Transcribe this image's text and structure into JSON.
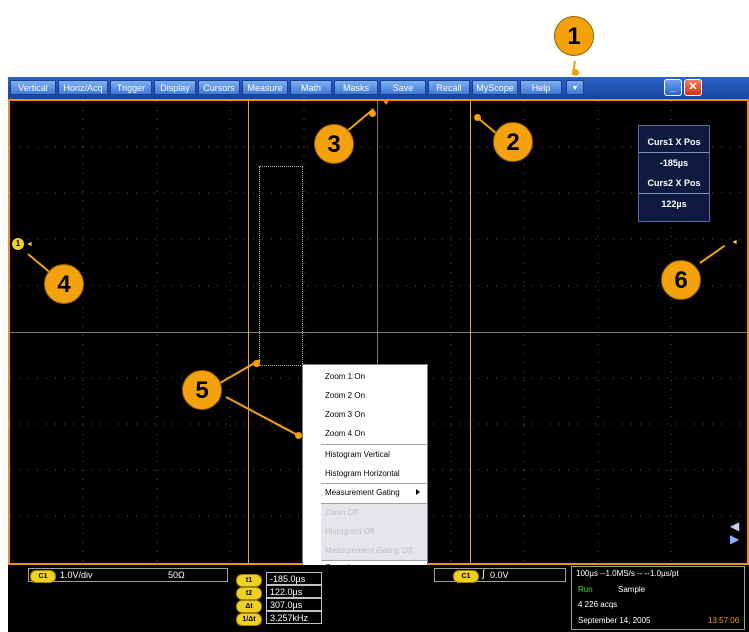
{
  "menubar": {
    "items": [
      "Vertical",
      "Horiz/Acq",
      "Trigger",
      "Display",
      "Cursors",
      "Measure",
      "Math",
      "Masks",
      "Save",
      "Recall",
      "MyScope",
      "Help"
    ],
    "dropdown_icon": "triangle-down-icon",
    "minimize_icon": "minimize-icon",
    "close_icon": "close-icon"
  },
  "readout": {
    "curs1_label": "Curs1 X Pos",
    "curs1_value": "-185µs",
    "curs2_label": "Curs2 X Pos",
    "curs2_value": "122µs"
  },
  "markers": {
    "ch1_marker": "1"
  },
  "context_menu": {
    "items": [
      {
        "label": "Zoom 1 On",
        "enabled": true
      },
      {
        "label": "Zoom 2 On",
        "enabled": true
      },
      {
        "label": "Zoom 3 On",
        "enabled": true
      },
      {
        "label": "Zoom 4 On",
        "enabled": true
      },
      {
        "label": "Histogram Vertical",
        "enabled": true
      },
      {
        "label": "Histogram Horizontal",
        "enabled": true
      },
      {
        "label": "Measurement Gating",
        "enabled": true,
        "submenu": true
      },
      {
        "label": "Zoom Off",
        "enabled": false
      },
      {
        "label": "Histogram Off",
        "enabled": false
      },
      {
        "label": "Measurement Gating Off",
        "enabled": false
      },
      {
        "label": "Cancel",
        "enabled": true
      }
    ]
  },
  "bottom": {
    "ch_chip": "C1",
    "scale": "1.0V/div",
    "impedance": "50Ω",
    "cursor_rows": [
      {
        "chip": "t1",
        "value": "-185.0µs"
      },
      {
        "chip": "t2",
        "value": "122.0µs"
      },
      {
        "chip": "Δt",
        "value": "307.0µs"
      },
      {
        "chip": "1/Δt",
        "value": "3.257kHz"
      }
    ],
    "trigger_chip": "C1",
    "trigger_level": "0.0V",
    "horizontal": "100µs   --1.0MS/s   --   --1.0µs/pt",
    "run_state": "Run",
    "acq_mode": "Sample",
    "acqs": "4 226 acqs",
    "date": "September 14, 2005",
    "time": "13:57:06"
  },
  "callouts": [
    "1",
    "2",
    "3",
    "4",
    "5",
    "6"
  ],
  "colors": {
    "accent": "#f4a10e",
    "screen_border": "#f09020",
    "cursor": "#d8b030",
    "run": "#30e030",
    "time": "#f0a020"
  }
}
